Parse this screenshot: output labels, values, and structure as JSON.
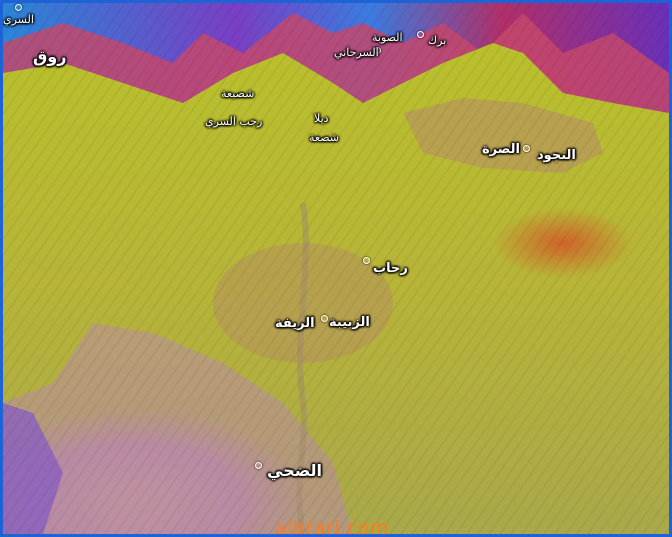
{
  "map": {
    "labels": {
      "sarri_tl": "السري",
      "rawq": "روق",
      "shabaa": "شصبعة",
      "rajab_sarri": "رجب السري",
      "dyla": "ديلا",
      "shasaa": "شصعة",
      "sarhani": "السرحاني",
      "birk": "برك",
      "sawba": "الصوبة",
      "najud": "النجود",
      "sura": "الصرة",
      "rahab": "رحاب",
      "zubayba": "الزبيبة",
      "rifa": "الريفة",
      "duhi": "الضحي"
    },
    "watermark": "albrari.com"
  }
}
